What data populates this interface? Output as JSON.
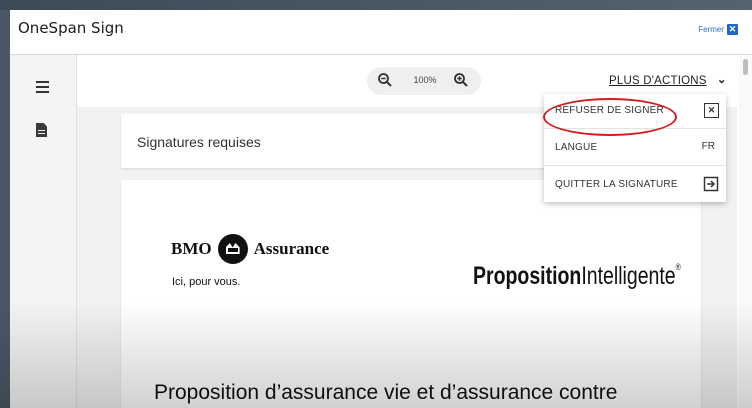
{
  "app": {
    "title": "OneSpan Sign",
    "close_label": "Fermer",
    "close_icon": "close-icon"
  },
  "toolbar": {
    "zoom_level": "100%",
    "more_actions_label": "PLUS D'ACTIONS"
  },
  "menu": {
    "items": [
      {
        "label": "REFUSER DE SIGNER",
        "right": "",
        "icon": "close-box-icon"
      },
      {
        "label": "LANGUE",
        "right": "FR",
        "icon": ""
      },
      {
        "label": "QUITTER LA SIGNATURE",
        "right": "",
        "icon": "exit-icon"
      }
    ]
  },
  "content": {
    "required_signatures_title": "Signatures requises",
    "document": {
      "bmo_name": "BMO",
      "bmo_product": "Assurance",
      "bmo_tagline": "Ici, pour vous.",
      "proposition_bold": "Proposition",
      "proposition_light": "Intelligente",
      "registered_mark": "®",
      "heading": "Proposition d’assurance vie et d’assurance contre"
    }
  },
  "colors": {
    "accent": "#1f66c9",
    "highlight_circle": "#d21d1d"
  }
}
